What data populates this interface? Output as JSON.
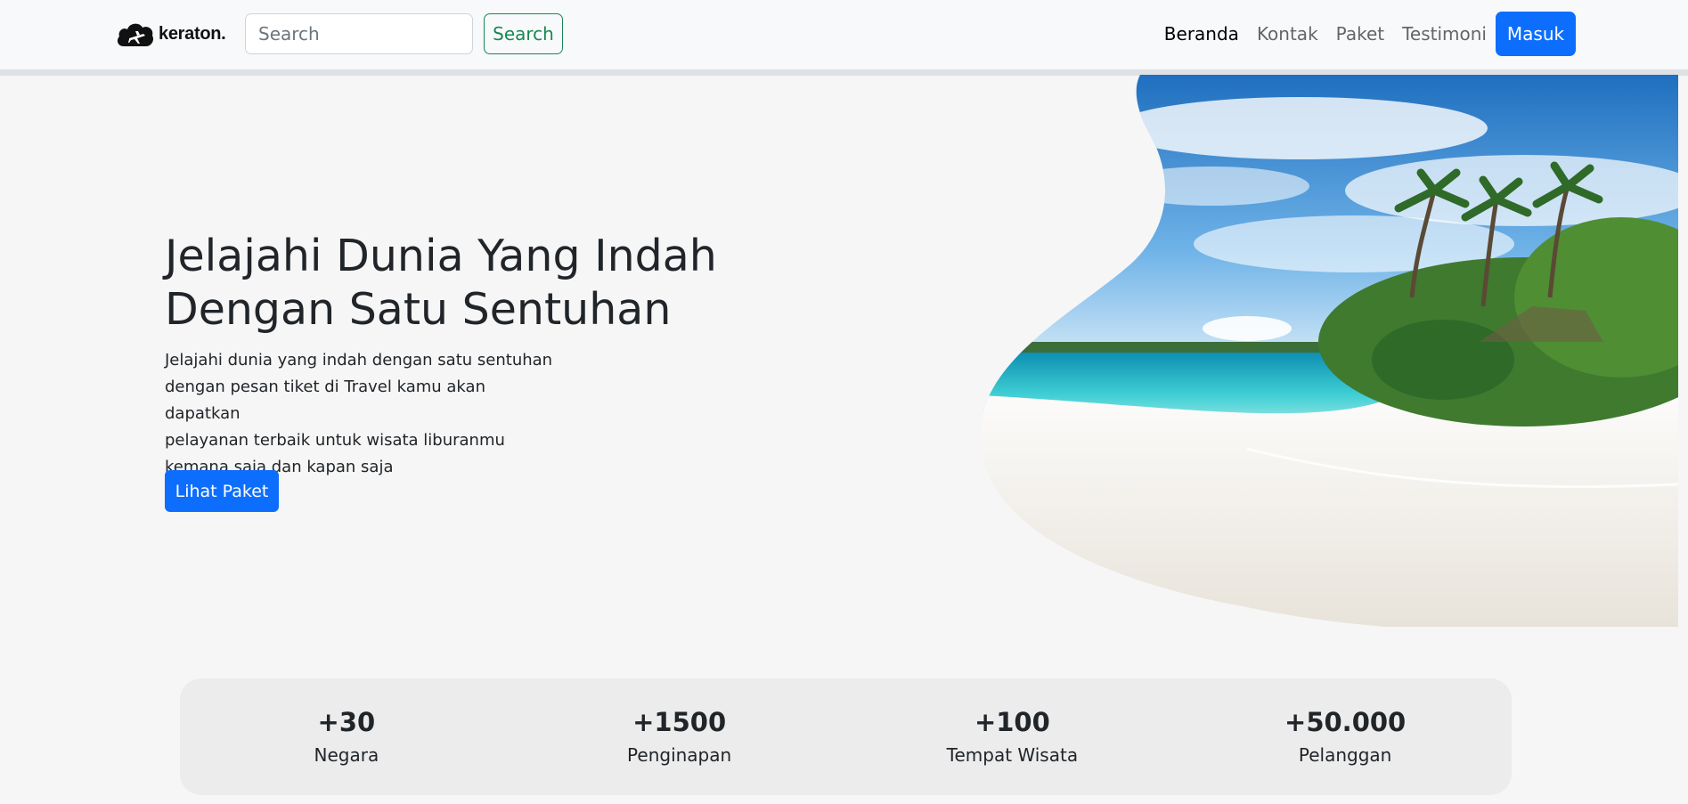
{
  "brand": {
    "name": "keraton.",
    "logo_icon": "cloud-plane-icon"
  },
  "search": {
    "placeholder": "Search",
    "button_label": "Search"
  },
  "nav": {
    "links": [
      {
        "label": "Beranda",
        "active": true
      },
      {
        "label": "Kontak",
        "active": false
      },
      {
        "label": "Paket",
        "active": false
      },
      {
        "label": "Testimoni",
        "active": false
      }
    ],
    "login_label": "Masuk"
  },
  "hero": {
    "title_line1": "Jelajahi Dunia Yang Indah",
    "title_line2": "Dengan Satu Sentuhan",
    "desc_lines": [
      "Jelajahi dunia yang indah dengan satu sentuhan",
      "dengan pesan tiket di Travel kamu akan dapatkan",
      "pelayanan terbaik untuk wisata liburanmu",
      "kemana saja dan kapan saja"
    ],
    "cta_label": "Lihat Paket"
  },
  "stats": [
    {
      "value": "+30",
      "label": "Negara"
    },
    {
      "value": "+1500",
      "label": "Penginapan"
    },
    {
      "value": "+100",
      "label": "Tempat Wisata"
    },
    {
      "value": "+50.000",
      "label": "Pelanggan"
    }
  ],
  "colors": {
    "primary": "#0d6efd",
    "success": "#198754",
    "navbar_bg": "#f8f9fa",
    "page_bg": "#f6f6f6",
    "stats_bg": "#ececec"
  }
}
